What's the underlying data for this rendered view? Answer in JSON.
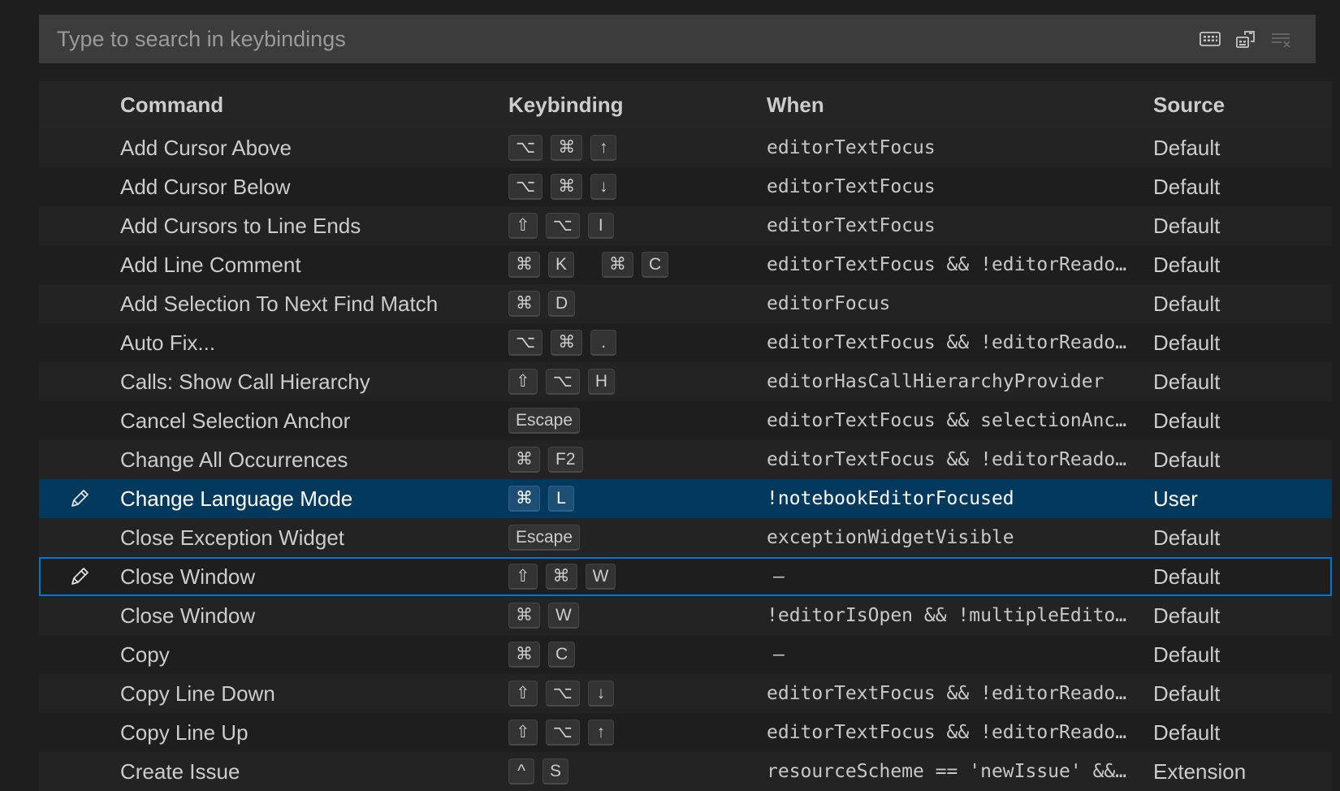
{
  "search": {
    "placeholder": "Type to search in keybindings",
    "value": "",
    "actions": [
      {
        "name": "record-keys-icon"
      },
      {
        "name": "sort-by-precedence-icon"
      },
      {
        "name": "clear-search-icon"
      }
    ]
  },
  "columns": {
    "command": "Command",
    "keybinding": "Keybinding",
    "when": "When",
    "source": "Source"
  },
  "rows": [
    {
      "command": "Add Cursor Above",
      "keys": [
        [
          "⌥",
          "⌘",
          "↑"
        ]
      ],
      "when": "editorTextFocus",
      "source": "Default"
    },
    {
      "command": "Add Cursor Below",
      "keys": [
        [
          "⌥",
          "⌘",
          "↓"
        ]
      ],
      "when": "editorTextFocus",
      "source": "Default"
    },
    {
      "command": "Add Cursors to Line Ends",
      "keys": [
        [
          "⇧",
          "⌥",
          "I"
        ]
      ],
      "when": "editorTextFocus",
      "source": "Default"
    },
    {
      "command": "Add Line Comment",
      "keys": [
        [
          "⌘",
          "K"
        ],
        [
          "⌘",
          "C"
        ]
      ],
      "when": "editorTextFocus && !editorReado…",
      "source": "Default"
    },
    {
      "command": "Add Selection To Next Find Match",
      "keys": [
        [
          "⌘",
          "D"
        ]
      ],
      "when": "editorFocus",
      "source": "Default"
    },
    {
      "command": "Auto Fix...",
      "keys": [
        [
          "⌥",
          "⌘",
          "."
        ]
      ],
      "when": "editorTextFocus && !editorReado…",
      "source": "Default"
    },
    {
      "command": "Calls: Show Call Hierarchy",
      "keys": [
        [
          "⇧",
          "⌥",
          "H"
        ]
      ],
      "when": "editorHasCallHierarchyProvider",
      "source": "Default"
    },
    {
      "command": "Cancel Selection Anchor",
      "keys": [
        [
          "Escape"
        ]
      ],
      "when": "editorTextFocus && selectionAnc…",
      "source": "Default"
    },
    {
      "command": "Change All Occurrences",
      "keys": [
        [
          "⌘",
          "F2"
        ]
      ],
      "when": "editorTextFocus && !editorReado…",
      "source": "Default"
    },
    {
      "command": "Change Language Mode",
      "keys": [
        [
          "⌘",
          "L"
        ]
      ],
      "when": "!notebookEditorFocused",
      "source": "User",
      "selected": true,
      "edit": true
    },
    {
      "command": "Close Exception Widget",
      "keys": [
        [
          "Escape"
        ]
      ],
      "when": "exceptionWidgetVisible",
      "source": "Default"
    },
    {
      "command": "Close Window",
      "keys": [
        [
          "⇧",
          "⌘",
          "W"
        ]
      ],
      "when": "–",
      "source": "Default",
      "focused": true,
      "edit": true
    },
    {
      "command": "Close Window",
      "keys": [
        [
          "⌘",
          "W"
        ]
      ],
      "when": "!editorIsOpen && !multipleEdito…",
      "source": "Default"
    },
    {
      "command": "Copy",
      "keys": [
        [
          "⌘",
          "C"
        ]
      ],
      "when": "–",
      "source": "Default"
    },
    {
      "command": "Copy Line Down",
      "keys": [
        [
          "⇧",
          "⌥",
          "↓"
        ]
      ],
      "when": "editorTextFocus && !editorReado…",
      "source": "Default"
    },
    {
      "command": "Copy Line Up",
      "keys": [
        [
          "⇧",
          "⌥",
          "↑"
        ]
      ],
      "when": "editorTextFocus && !editorReado…",
      "source": "Default"
    },
    {
      "command": "Create Issue",
      "keys": [
        [
          "^",
          "S"
        ]
      ],
      "when": "resourceScheme == 'newIssue' &&…",
      "source": "Extension"
    }
  ],
  "colors": {
    "selected_row": "#04395e",
    "focus_border": "#0078d4",
    "search_bg": "#3c3c3c"
  }
}
